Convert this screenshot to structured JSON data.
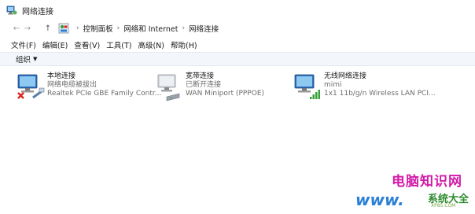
{
  "window": {
    "title": "网络连接"
  },
  "address": {
    "back_icon": "←",
    "forward_icon": "→",
    "up_icon": "↑",
    "crumbs": [
      "控制面板",
      "网络和 Internet",
      "网络连接"
    ]
  },
  "menu": [
    "文件(F)",
    "编辑(E)",
    "查看(V)",
    "工具(T)",
    "高级(N)",
    "帮助(H)"
  ],
  "toolbar": {
    "organize": "组织",
    "caret": "▼"
  },
  "connections": [
    {
      "name": "本地连接",
      "status": "网络电缆被拔出",
      "device": "Realtek PCIe GBE Family Contr..."
    },
    {
      "name": "宽带连接",
      "status": "已断开连接",
      "device": "WAN Miniport (PPPOE)"
    },
    {
      "name": "无线网络连接",
      "status": "mimi",
      "device": "1x1 11b/g/n Wireless LAN PCI..."
    }
  ],
  "watermark": {
    "line1": "电脑知识网",
    "line2": "www.",
    "line3": "系统大全",
    "line4": "XP85.COM"
  },
  "colors": {
    "accent_blue": "#2a7fd6",
    "error_red": "#d9261c",
    "signal_green": "#3aa03a",
    "watermark_pink": "#d21aa8"
  }
}
